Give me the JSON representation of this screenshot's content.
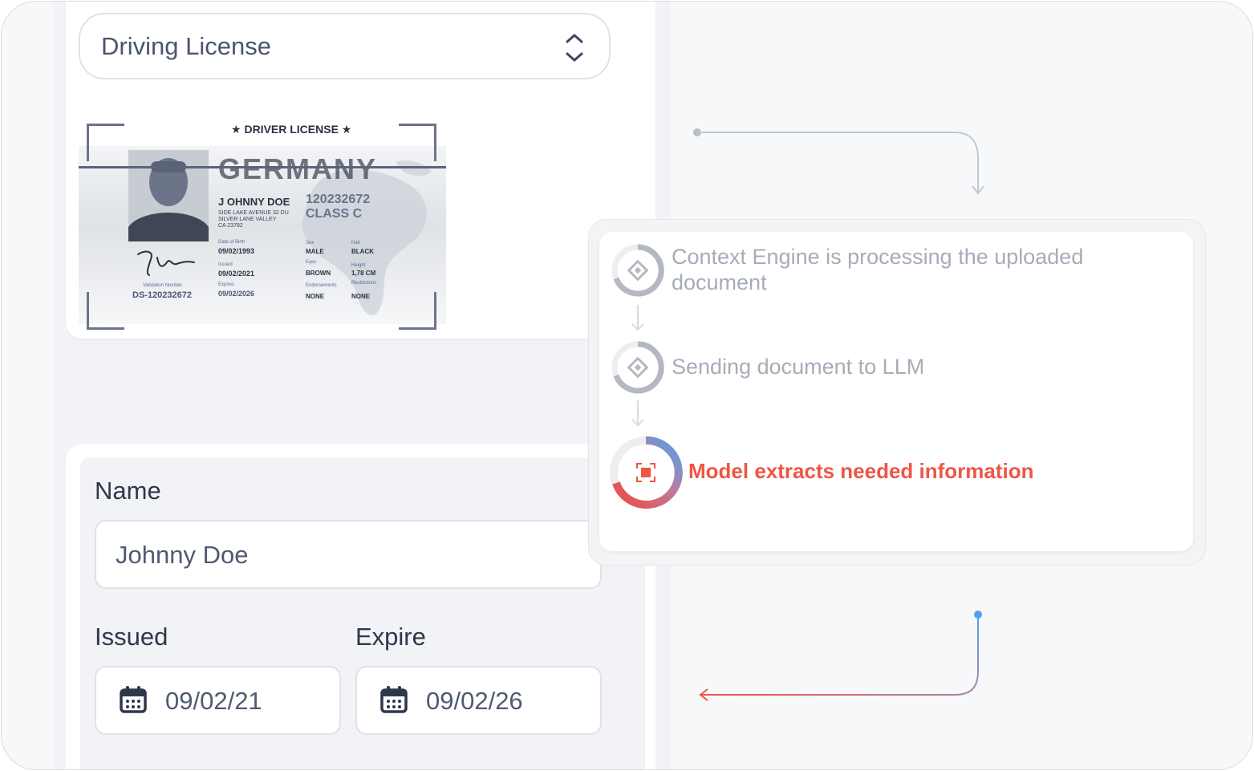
{
  "document_type": {
    "selected": "Driving License"
  },
  "license": {
    "title": "DRIVER LICENSE",
    "country": "GERMANY",
    "holder_name": "J OHNNY DOE",
    "license_number": "120232672",
    "class": "CLASS C",
    "address": [
      "SIDE LAKE AVENUE 32 DU",
      "SILVER LANE VALLEY",
      "CA 23782"
    ],
    "dob_label": "Date of Birth",
    "dob": "09/02/1993",
    "issued_label": "Issued",
    "issued": "09/02/2021",
    "expires_label": "Expires",
    "expires": "09/02/2026",
    "validation_label": "Validation Number",
    "validation_number": "DS-120232672",
    "sex_label": "Sex",
    "sex": "MALE",
    "hair_label": "Hair",
    "hair": "BLACK",
    "eyes_label": "Eyes",
    "eyes": "BROWN",
    "height_label": "Height",
    "height": "1,78 CM",
    "endorsements_label": "Endorsements",
    "endorsements": "NONE",
    "restrictions_label": "Restrictions",
    "restrictions": "NONE"
  },
  "form": {
    "name_label": "Name",
    "name_value": "Johnny Doe",
    "issued_label": "Issued",
    "issued_value": "09/02/21",
    "expire_label": "Expire",
    "expire_value": "09/02/26"
  },
  "process": {
    "steps": [
      {
        "label": "Context Engine is processing the uploaded document",
        "state": "done"
      },
      {
        "label": "Sending document to LLM",
        "state": "done"
      },
      {
        "label": "Model extracts needed information",
        "state": "active"
      }
    ]
  },
  "colors": {
    "accent_red": "#ef5545",
    "accent_blue": "#4ea3f0",
    "muted_gray": "#a6acb8"
  }
}
